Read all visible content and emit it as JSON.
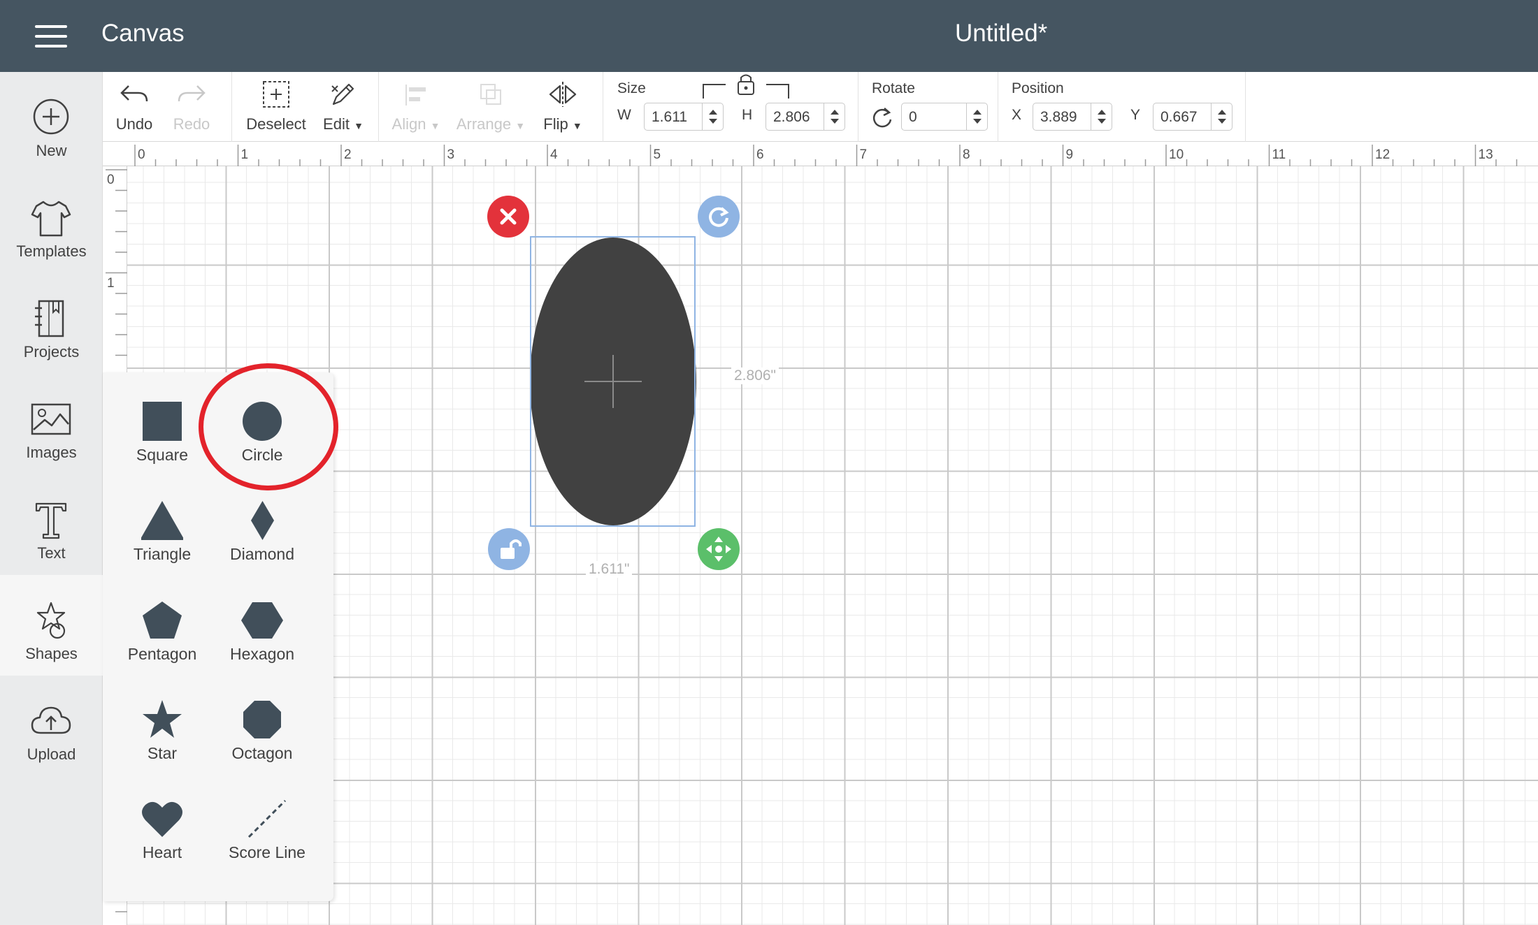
{
  "app": {
    "title": "Canvas",
    "document_title": "Untitled*"
  },
  "sidebar": {
    "items": [
      {
        "id": "new",
        "label": "New",
        "icon": "plus-circle-icon"
      },
      {
        "id": "templates",
        "label": "Templates",
        "icon": "tshirt-icon"
      },
      {
        "id": "projects",
        "label": "Projects",
        "icon": "notebook-icon"
      },
      {
        "id": "images",
        "label": "Images",
        "icon": "image-icon"
      },
      {
        "id": "text",
        "label": "Text",
        "icon": "text-t-icon"
      },
      {
        "id": "shapes",
        "label": "Shapes",
        "icon": "shapes-icon",
        "active": true
      },
      {
        "id": "upload",
        "label": "Upload",
        "icon": "cloud-upload-icon"
      }
    ]
  },
  "toolbar": {
    "undo": "Undo",
    "redo": "Redo",
    "deselect": "Deselect",
    "edit": "Edit",
    "align": "Align",
    "arrange": "Arrange",
    "flip": "Flip",
    "size": {
      "label": "Size",
      "w_label": "W",
      "w_value": "1.611",
      "h_label": "H",
      "h_value": "2.806"
    },
    "rotate": {
      "label": "Rotate",
      "value": "0"
    },
    "position": {
      "label": "Position",
      "x_label": "X",
      "x_value": "3.889",
      "y_label": "Y",
      "y_value": "0.667"
    }
  },
  "ruler": {
    "top_labels": [
      "0",
      "1",
      "2",
      "3",
      "4",
      "5",
      "6",
      "7",
      "8",
      "9",
      "10",
      "11",
      "12",
      "13"
    ],
    "left_labels": [
      "0",
      "1"
    ]
  },
  "shapes_panel": {
    "items": [
      {
        "label": "Square",
        "icon": "square-icon"
      },
      {
        "label": "Circle",
        "icon": "circle-icon",
        "highlighted": true
      },
      {
        "label": "Triangle",
        "icon": "triangle-icon"
      },
      {
        "label": "Diamond",
        "icon": "diamond-icon"
      },
      {
        "label": "Pentagon",
        "icon": "pentagon-icon"
      },
      {
        "label": "Hexagon",
        "icon": "hexagon-icon"
      },
      {
        "label": "Star",
        "icon": "star-icon"
      },
      {
        "label": "Octagon",
        "icon": "octagon-icon"
      },
      {
        "label": "Heart",
        "icon": "heart-icon"
      },
      {
        "label": "Score Line",
        "icon": "score-line-icon"
      }
    ]
  },
  "selection": {
    "width_label": "1.611\"",
    "height_label": "2.806\""
  },
  "colors": {
    "topbar": "#455561",
    "shape_fill": "#414141",
    "delete_handle": "#e3323b",
    "rotate_handle": "#8fb4e3",
    "scale_handle": "#5bbf6a",
    "highlight_ring": "#e3232b"
  }
}
